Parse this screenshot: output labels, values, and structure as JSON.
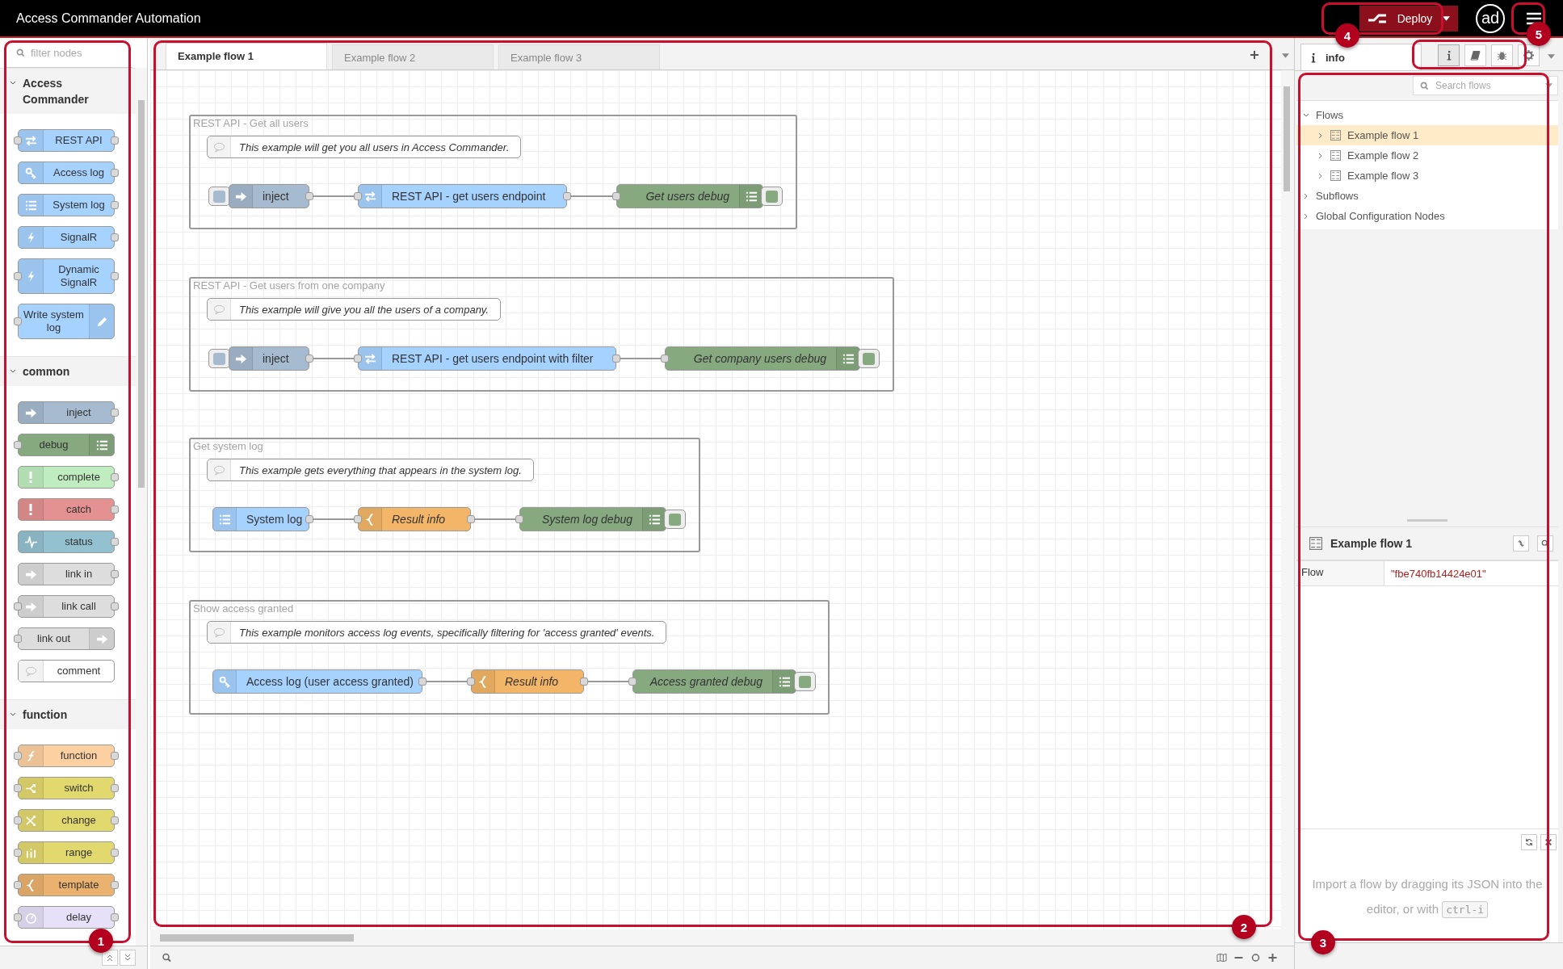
{
  "header": {
    "title": "Access Commander Automation",
    "deploy": "Deploy",
    "user": "ad"
  },
  "palette": {
    "filter_placeholder": "filter nodes",
    "categories": [
      {
        "name": "Access Commander",
        "expanded": true,
        "nodes": [
          {
            "label": "REST API",
            "kind": "rest-api",
            "color": "#a6d2ff",
            "input": true,
            "output": true,
            "icon_right": false
          },
          {
            "label": "Access log",
            "kind": "access-log",
            "color": "#a6d2ff",
            "input": false,
            "output": true,
            "icon_right": false
          },
          {
            "label": "System log",
            "kind": "system-log",
            "color": "#a6d2ff",
            "input": false,
            "output": true,
            "icon_right": false
          },
          {
            "label": "SignalR",
            "kind": "signalr",
            "color": "#a6d2ff",
            "input": false,
            "output": true,
            "icon_right": false
          },
          {
            "label": "Dynamic SignalR",
            "kind": "signalr",
            "color": "#a6d2ff",
            "input": true,
            "output": true,
            "icon_right": false
          },
          {
            "label": "Write system log",
            "kind": "write-log",
            "color": "#a6d2ff",
            "input": true,
            "output": false,
            "icon_right": true
          }
        ]
      },
      {
        "name": "common",
        "expanded": true,
        "nodes": [
          {
            "label": "inject",
            "kind": "inject",
            "color": "#a6bbcf",
            "input": false,
            "output": true,
            "icon_right": false
          },
          {
            "label": "debug",
            "kind": "debug",
            "color": "#87a980",
            "input": true,
            "output": false,
            "icon_right": true
          },
          {
            "label": "complete",
            "kind": "complete",
            "color": "#c0edc0",
            "input": false,
            "output": true,
            "icon_right": false
          },
          {
            "label": "catch",
            "kind": "catch",
            "color": "#e49191",
            "input": false,
            "output": true,
            "icon_right": false
          },
          {
            "label": "status",
            "kind": "status",
            "color": "#94c1d0",
            "input": false,
            "output": true,
            "icon_right": false
          },
          {
            "label": "link in",
            "kind": "link-in",
            "color": "#dddddd",
            "input": false,
            "output": true,
            "icon_right": false
          },
          {
            "label": "link call",
            "kind": "link-call",
            "color": "#dddddd",
            "input": true,
            "output": true,
            "icon_right": false
          },
          {
            "label": "link out",
            "kind": "link-out",
            "color": "#dddddd",
            "input": true,
            "output": false,
            "icon_right": true
          },
          {
            "label": "comment",
            "kind": "comment",
            "color": "#ffffff",
            "input": false,
            "output": false,
            "icon_right": false
          }
        ]
      },
      {
        "name": "function",
        "expanded": true,
        "nodes": [
          {
            "label": "function",
            "kind": "function",
            "color": "#fdd0a2",
            "input": true,
            "output": true,
            "icon_right": false
          },
          {
            "label": "switch",
            "kind": "switch",
            "color": "#e2d96e",
            "input": true,
            "output": true,
            "icon_right": false
          },
          {
            "label": "change",
            "kind": "change",
            "color": "#e2d96e",
            "input": true,
            "output": true,
            "icon_right": false
          },
          {
            "label": "range",
            "kind": "range",
            "color": "#e2d96e",
            "input": true,
            "output": true,
            "icon_right": false
          },
          {
            "label": "template",
            "kind": "template",
            "color": "#ebb16e",
            "input": true,
            "output": true,
            "icon_right": false
          },
          {
            "label": "delay",
            "kind": "delay",
            "color": "#e6e0f8",
            "input": true,
            "output": true,
            "icon_right": false
          }
        ]
      }
    ]
  },
  "tabs": [
    {
      "label": "Example flow 1",
      "selected": true
    },
    {
      "label": "Example flow 2",
      "selected": false
    },
    {
      "label": "Example flow 3",
      "selected": false
    }
  ],
  "flow_groups": [
    {
      "title": "REST API - Get all users",
      "comment": "This example will get you all users in Access Commander.",
      "nodes": [
        {
          "label": "inject",
          "kind": "inject",
          "color": "#a6bbcf",
          "input": false,
          "output": true
        },
        {
          "label": "REST API - get users endpoint",
          "kind": "rest-api",
          "color": "#a6d2ff",
          "input": true,
          "output": true
        },
        {
          "label": "Get users debug",
          "kind": "debug",
          "color": "#87a980",
          "input": true,
          "output": false,
          "enabled": true
        }
      ]
    },
    {
      "title": "REST API - Get users from one company",
      "comment": "This example will give you all the users of a company.",
      "nodes": [
        {
          "label": "inject",
          "kind": "inject",
          "color": "#a6bbcf",
          "input": false,
          "output": true
        },
        {
          "label": "REST API - get users endpoint with filter",
          "kind": "rest-api",
          "color": "#a6d2ff",
          "input": true,
          "output": true
        },
        {
          "label": "Get company users debug",
          "kind": "debug",
          "color": "#87a980",
          "input": true,
          "output": false,
          "enabled": true
        }
      ]
    },
    {
      "title": "Get system log",
      "comment": "This example gets everything that appears in the system log.",
      "nodes": [
        {
          "label": "System log",
          "kind": "system-log",
          "color": "#a6d2ff",
          "input": false,
          "output": true
        },
        {
          "label": "Result info",
          "kind": "template",
          "color": "#f3b567",
          "input": true,
          "output": true
        },
        {
          "label": "System log debug",
          "kind": "debug",
          "color": "#87a980",
          "input": true,
          "output": false,
          "enabled": true
        }
      ]
    },
    {
      "title": "Show access granted",
      "comment": "This example monitors access log events, specifically filtering for 'access granted' events.",
      "nodes": [
        {
          "label": "Access log (user access granted)",
          "kind": "access-log",
          "color": "#a6d2ff",
          "input": false,
          "output": true
        },
        {
          "label": "Result info",
          "kind": "template",
          "color": "#f3b567",
          "input": true,
          "output": true
        },
        {
          "label": "Access granted debug",
          "kind": "debug",
          "color": "#87a980",
          "input": true,
          "output": false,
          "enabled": true
        }
      ]
    }
  ],
  "sidebar": {
    "tab": "info",
    "buttons": [
      {
        "kind": "info",
        "selected": true
      },
      {
        "kind": "book",
        "selected": false
      },
      {
        "kind": "bug",
        "selected": false
      },
      {
        "kind": "gear",
        "selected": false
      }
    ],
    "search_placeholder": "Search flows",
    "tree": [
      {
        "label": "Flows",
        "expanded": true,
        "selected": false,
        "children": [
          {
            "label": "Example flow 1",
            "expanded": false,
            "selected": true
          },
          {
            "label": "Example flow 2",
            "expanded": false,
            "selected": false
          },
          {
            "label": "Example flow 3",
            "expanded": false,
            "selected": false
          }
        ]
      },
      {
        "label": "Subflows",
        "expanded": false,
        "selected": false
      },
      {
        "label": "Global Configuration Nodes",
        "expanded": false,
        "selected": false
      }
    ],
    "info_title": "Example flow 1",
    "properties": [
      {
        "name": "Flow",
        "value": "\"fbe740fb14424e01\""
      }
    ],
    "tip": "Import a flow by dragging its JSON into the editor, or with",
    "tip_shortcut": "ctrl-i"
  },
  "callouts": [
    {
      "number": "1"
    },
    {
      "number": "2"
    },
    {
      "number": "3"
    },
    {
      "number": "4"
    },
    {
      "number": "5"
    }
  ]
}
